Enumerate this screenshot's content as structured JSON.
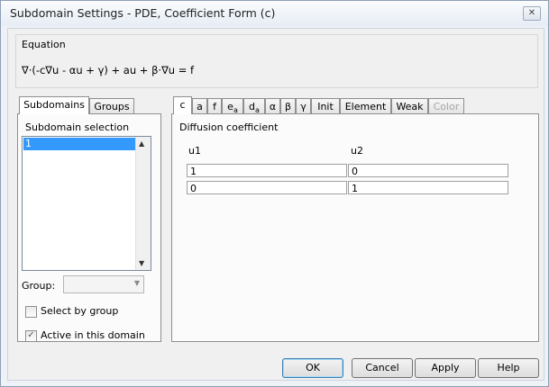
{
  "window": {
    "title": "Subdomain Settings - PDE, Coefficient Form (c)",
    "close_icon": "close-icon"
  },
  "equation": {
    "label": "Equation",
    "text": "∇·(-c∇u - αu + γ) + au + β·∇u = f"
  },
  "left_tabs": [
    "Subdomains",
    "Groups"
  ],
  "subdomain_selection": {
    "title": "Subdomain selection",
    "items": [
      "1"
    ],
    "group_label": "Group:",
    "group_value": "",
    "select_by_group": {
      "label": "Select by group",
      "checked": false
    },
    "active_in_domain": {
      "label": "Active in this domain",
      "checked": true
    }
  },
  "right_tabs": [
    {
      "main": "c",
      "sub": ""
    },
    {
      "main": "a",
      "sub": ""
    },
    {
      "main": "f",
      "sub": ""
    },
    {
      "main": "e",
      "sub": "a"
    },
    {
      "main": "d",
      "sub": "a"
    },
    {
      "main": "α",
      "sub": ""
    },
    {
      "main": "β",
      "sub": ""
    },
    {
      "main": "γ",
      "sub": ""
    },
    {
      "main": "Init",
      "sub": ""
    },
    {
      "main": "Element",
      "sub": ""
    },
    {
      "main": "Weak",
      "sub": ""
    },
    {
      "main": "Color",
      "sub": ""
    }
  ],
  "diffusion": {
    "title": "Diffusion coefficient",
    "columns": [
      "u1",
      "u2"
    ],
    "rows": [
      [
        "1",
        "0"
      ],
      [
        "0",
        "1"
      ]
    ]
  },
  "buttons": {
    "ok": "OK",
    "cancel": "Cancel",
    "apply": "Apply",
    "help": "Help"
  }
}
